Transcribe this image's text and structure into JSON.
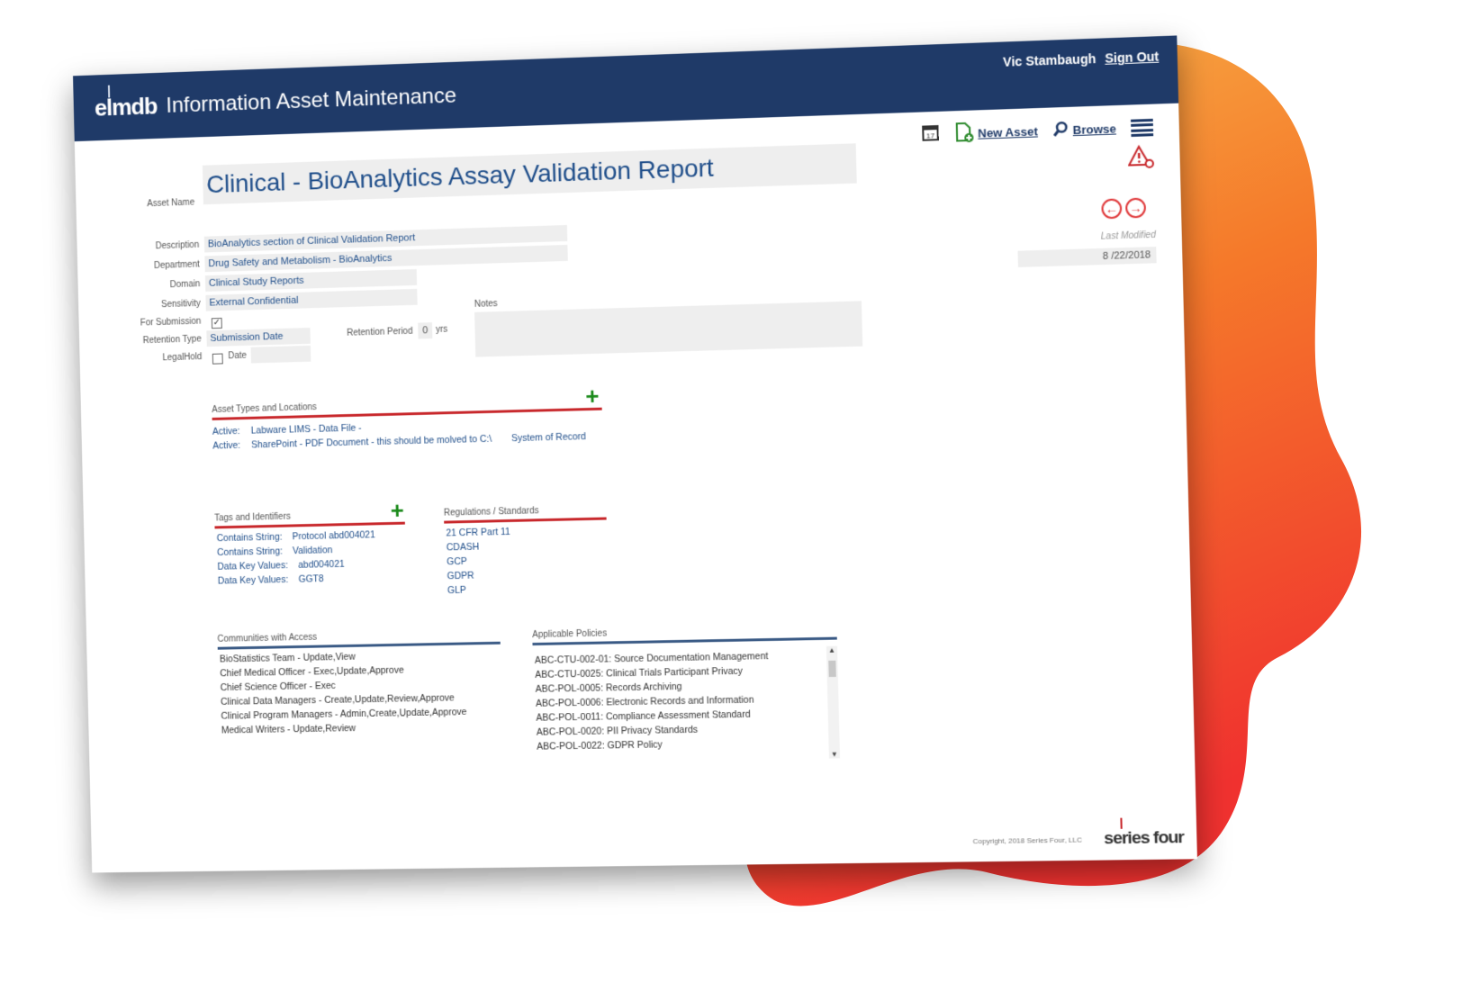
{
  "header": {
    "logo": "elmdb",
    "title": "Information Asset Maintenance",
    "user": "Vic Stambaugh",
    "sign_out": "Sign Out"
  },
  "toolbar": {
    "new_asset": "New Asset",
    "browse": "Browse"
  },
  "form": {
    "asset_name_label": "Asset Name",
    "asset_name": "Clinical - BioAnalytics Assay Validation Report",
    "description_label": "Description",
    "description": "BioAnalytics section of Clinical Validation Report",
    "department_label": "Department",
    "department": "Drug Safety and Metabolism - BioAnalytics",
    "domain_label": "Domain",
    "domain": "Clinical Study Reports",
    "sensitivity_label": "Sensitivity",
    "sensitivity": "External Confidential",
    "for_submission_label": "For Submission",
    "for_submission_checked": true,
    "retention_type_label": "Retention Type",
    "retention_type": "Submission Date",
    "retention_period_label": "Retention Period",
    "retention_period": "0",
    "retention_unit": "yrs",
    "legal_hold_label": "LegalHold",
    "legal_hold_checked": false,
    "date_label": "Date",
    "date": "",
    "notes_label": "Notes",
    "notes": ""
  },
  "last_modified": {
    "label": "Last Modified",
    "value": "8 /22/2018"
  },
  "asset_types": {
    "title": "Asset Types and Locations",
    "items": [
      {
        "status": "Active:",
        "text": "Labware LIMS - Data File -",
        "extra": ""
      },
      {
        "status": "Active:",
        "text": "SharePoint - PDF Document - this should be molved to C:\\",
        "extra": "System of Record"
      }
    ]
  },
  "tags": {
    "title": "Tags and Identifiers",
    "items": [
      {
        "key": "Contains String:",
        "value": "Protocol abd004021"
      },
      {
        "key": "Contains String:",
        "value": "Validation"
      },
      {
        "key": "Data Key Values:",
        "value": "abd004021"
      },
      {
        "key": "Data Key Values:",
        "value": "GGT8"
      }
    ]
  },
  "regulations": {
    "title": "Regulations / Standards",
    "items": [
      "21 CFR Part 11",
      "CDASH",
      "GCP",
      "GDPR",
      "GLP"
    ]
  },
  "communities": {
    "title": "Communities with Access",
    "items": [
      "BioStatistics Team - Update,View",
      "Chief Medical Officer - Exec,Update,Approve",
      "Chief Science Officer - Exec",
      "Clinical Data Managers - Create,Update,Review,Approve",
      "Clinical Program Managers - Admin,Create,Update,Approve",
      "Medical Writers - Update,Review"
    ]
  },
  "policies": {
    "title": "Applicable Policies",
    "items": [
      "ABC-CTU-002-01: Source Documentation Management",
      "ABC-CTU-0025: Clinical Trials Participant Privacy",
      "ABC-POL-0005: Records Archiving",
      "ABC-POL-0006: Electronic Records and Information",
      "ABC-POL-0011: Compliance Assessment Standard",
      "ABC-POL-0020: PII Privacy Standards",
      "ABC-POL-0022: GDPR Policy"
    ]
  },
  "footer": {
    "copyright": "Copyright, 2018 Series Four, LLC",
    "brand": "series four"
  },
  "colors": {
    "header_bg": "#1f3a68",
    "accent_red": "#c8282c",
    "accent_green": "#1a8a1a",
    "field_text": "#1f4e8a"
  }
}
